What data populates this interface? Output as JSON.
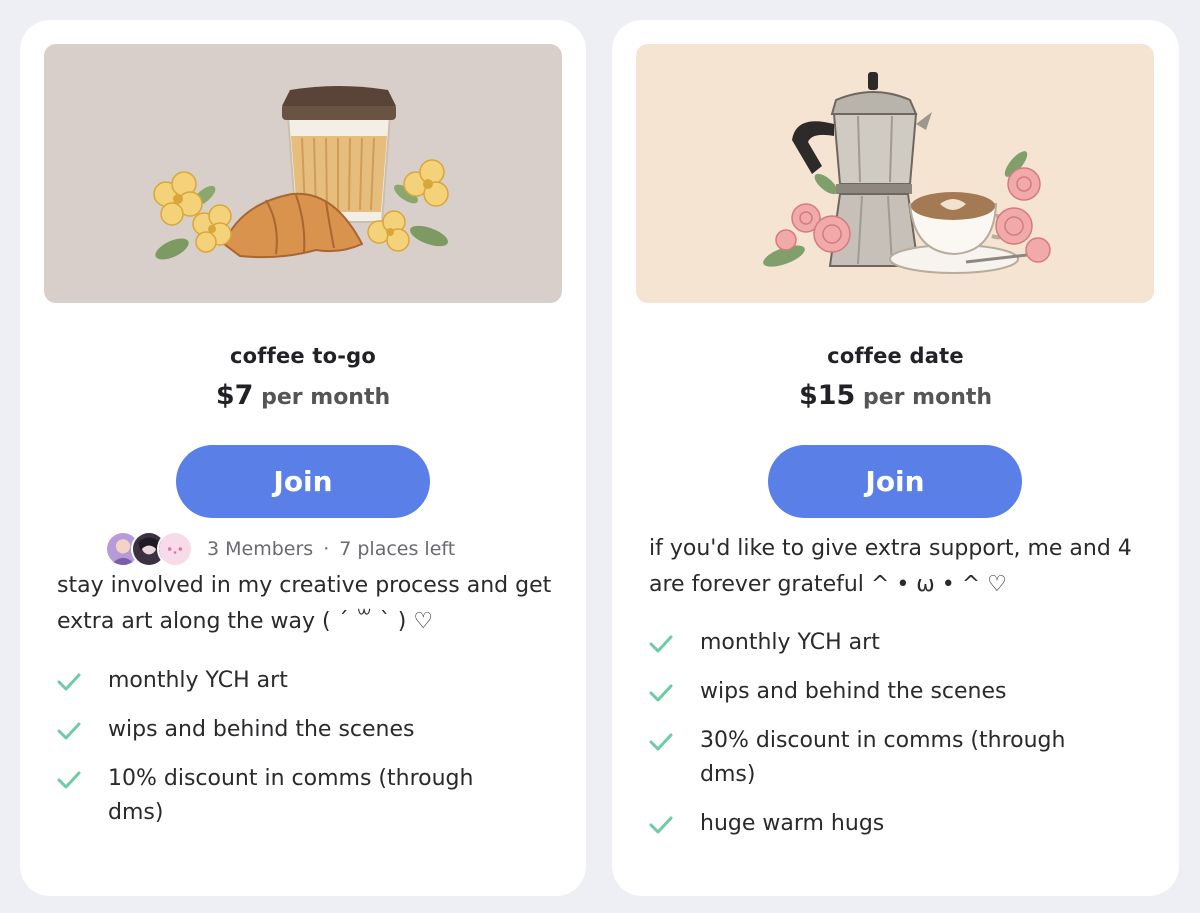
{
  "tiers": [
    {
      "name": "coffee to-go",
      "price_amount": "$7",
      "price_period": "per month",
      "join_label": "Join",
      "members_count": "3 Members",
      "places_left": "7 places left",
      "description": "stay involved in my creative process and get extra art along the way ( ´ ꒳ ` ) ♡",
      "perks": [
        "monthly YCH art",
        "wips and behind the scenes",
        "10% discount in comms (through dms)"
      ],
      "art_background": "#d9cfca",
      "illustration": "coffee-cup-croissant-flowers"
    },
    {
      "name": "coffee date",
      "price_amount": "$15",
      "price_period": "per month",
      "join_label": "Join",
      "description": "if you'd like to give extra support, me and 4 are forever grateful  ^ • ω • ^ ♡",
      "perks": [
        "monthly YCH art",
        "wips and behind the scenes",
        "30% discount in comms (through dms)",
        "huge warm hugs"
      ],
      "art_background": "#f6e4d3",
      "illustration": "moka-pot-latte-roses"
    }
  ],
  "colors": {
    "page_background": "#eeeff4",
    "card_background": "#ffffff",
    "join_button": "#5a80e8",
    "check_icon": "#6fcaa6"
  },
  "icons": {
    "perk": "check-icon"
  }
}
